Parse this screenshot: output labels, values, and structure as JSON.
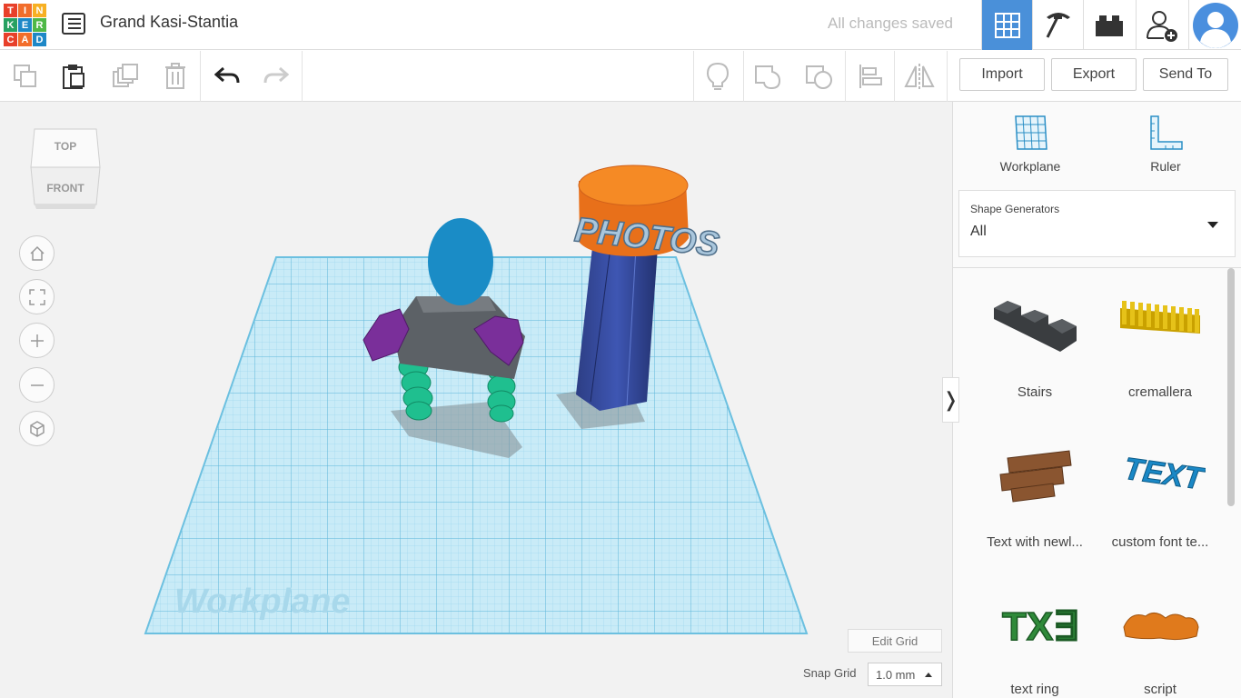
{
  "header": {
    "logo_letters": [
      "T",
      "I",
      "N",
      "K",
      "E",
      "R",
      "C",
      "A",
      "D"
    ],
    "logo_colors": [
      "#e8402a",
      "#f26d2b",
      "#f7b023",
      "#27a162",
      "#1e88c7",
      "#4fb847",
      "#e8402a",
      "#f26d2b",
      "#1e88c7"
    ],
    "project_title": "Grand Kasi-Stantia",
    "save_status": "All changes saved",
    "accent_color": "#4a90d9"
  },
  "toolbar": {
    "import_label": "Import",
    "export_label": "Export",
    "send_to_label": "Send To"
  },
  "viewport": {
    "viewcube_top": "TOP",
    "viewcube_front": "FRONT",
    "workplane_watermark": "Workplane",
    "photos_text": "PHOTOS",
    "edit_grid_label": "Edit Grid",
    "snap_grid_label": "Snap Grid",
    "snap_grid_value": "1.0 mm"
  },
  "panel": {
    "workplane_label": "Workplane",
    "ruler_label": "Ruler",
    "dropdown_caption": "Shape Generators",
    "dropdown_value": "All",
    "shapes": [
      {
        "label": "Stairs",
        "icon": "stairs-shape"
      },
      {
        "label": "cremallera",
        "icon": "rack-shape"
      },
      {
        "label": "Text with newl...",
        "icon": "text-newline-shape"
      },
      {
        "label": "custom font te...",
        "icon": "custom-font-text-shape"
      },
      {
        "label": "text ring",
        "icon": "text-ring-shape"
      },
      {
        "label": "script",
        "icon": "script-shape"
      }
    ]
  }
}
